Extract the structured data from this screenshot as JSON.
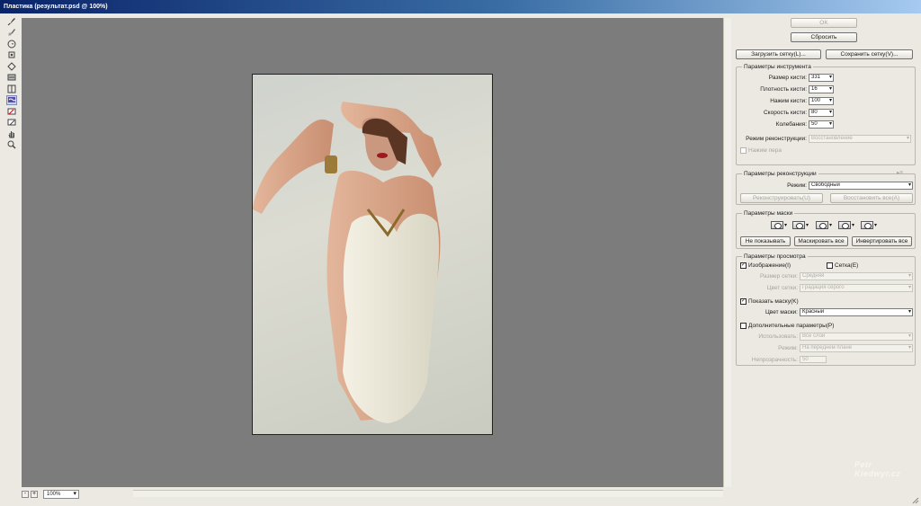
{
  "window": {
    "title": "Пластика (результат.psd @ 100%)"
  },
  "toolbox": [
    "forward-warp-icon",
    "reconstruct-icon",
    "twirl-icon",
    "pucker-icon",
    "bloat-icon",
    "push-left-icon",
    "mirror-icon",
    "turbulence-icon",
    "freeze-mask-icon",
    "thaw-mask-icon",
    "hand-icon",
    "zoom-icon"
  ],
  "statusbar": {
    "zoom_out": "-",
    "zoom_in": "+",
    "zoom": "100%"
  },
  "buttons": {
    "ok": "OK",
    "reset": "Сбросить",
    "load_mesh": "Загрузить сетку(L)...",
    "save_mesh": "Сохранить сетку(V)..."
  },
  "tool_options": {
    "title": "Параметры инструмента",
    "rows": [
      {
        "label": "Размер кисти:",
        "value": "331"
      },
      {
        "label": "Плотность кисти:",
        "value": "16"
      },
      {
        "label": "Нажим кисти:",
        "value": "100"
      },
      {
        "label": "Скорость кисти:",
        "value": "80"
      },
      {
        "label": "Колебания:",
        "value": "50"
      }
    ],
    "recon_mode_label": "Режим реконструкции:",
    "recon_mode_value": "Восстановление",
    "stylus_label": "Нажим пера"
  },
  "reconstruct": {
    "title": "Параметры реконструкции",
    "mode_label": "Режим:",
    "mode_value": "Свободный",
    "reconstruct_btn": "Реконструировать(U)",
    "restore_all_btn": "Восстановить все(A)"
  },
  "mask": {
    "title": "Параметры маски",
    "none_btn": "Не показывать",
    "mask_all_btn": "Маскировать все",
    "invert_all_btn": "Инвертировать все"
  },
  "view": {
    "title": "Параметры просмотра",
    "image_label": "Изображение(I)",
    "mesh_label": "Сетка(E)",
    "mesh_size_label": "Размер сетки:",
    "mesh_size_value": "Средняя",
    "mesh_color_label": "Цвет сетки:",
    "mesh_color_value": "Градация серого",
    "show_mask_label": "Показать маску(K)",
    "mask_color_label": "Цвет маски:",
    "mask_color_value": "Красный",
    "backdrop_label": "Дополнительные параметры(P)",
    "use_label": "Использовать:",
    "use_value": "Все слои",
    "mode_label": "Режим:",
    "mode_value": "На переднем плане",
    "opacity_label": "Непрозрачность:",
    "opacity_value": "50"
  },
  "watermark": {
    "line1": "Petr",
    "line2": "Kiedwyr.cz"
  }
}
